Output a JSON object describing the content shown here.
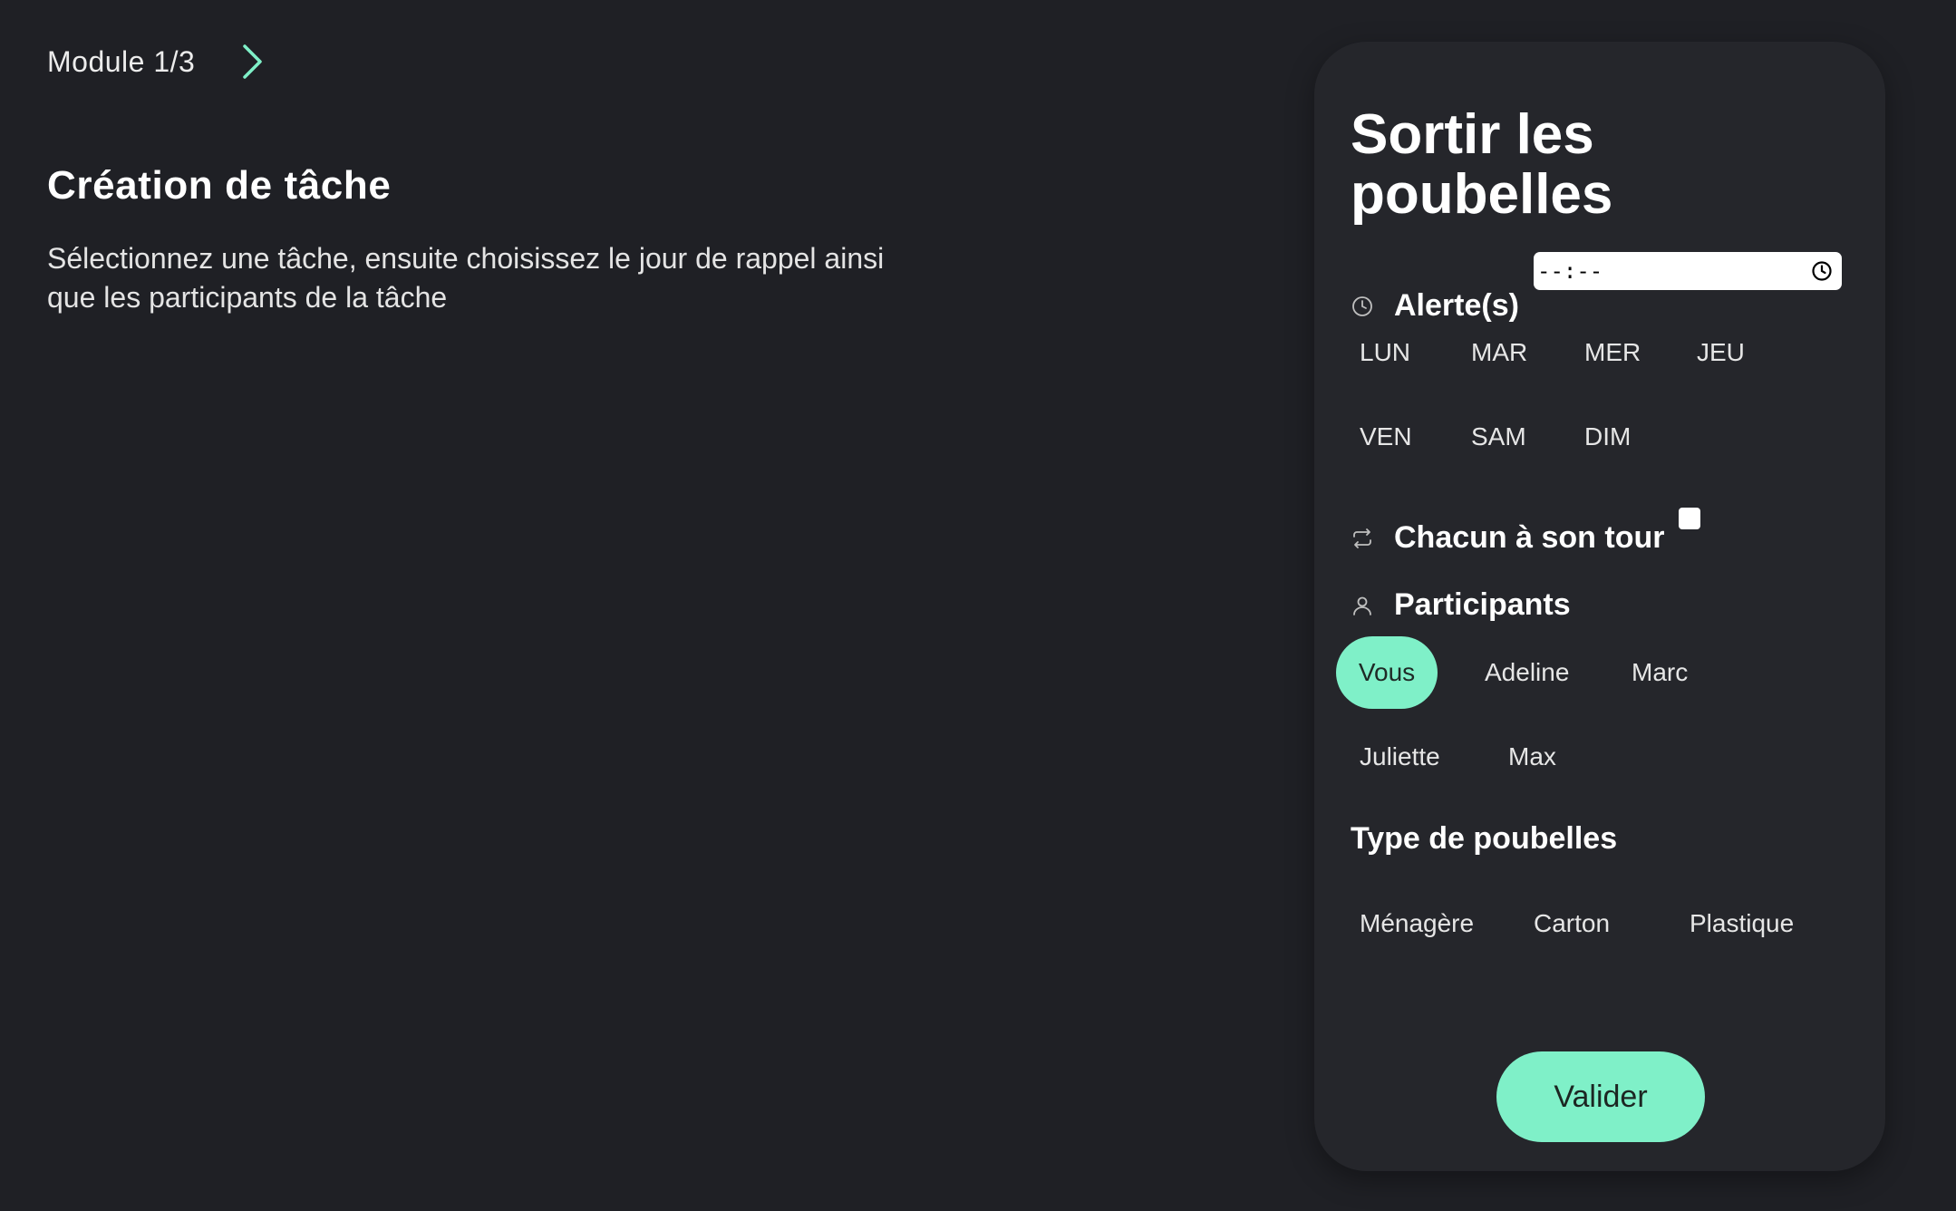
{
  "header": {
    "module_label": "Module 1/3",
    "next_icon": "chevron-right-icon"
  },
  "intro": {
    "title": "Création de tâche",
    "description": "Sélectionnez une tâche, ensuite choisissez le jour de rappel ainsi que les participants de la tâche"
  },
  "task_card": {
    "title": "Sortir les poubelles",
    "alert": {
      "icon": "clock-icon",
      "label": "Alerte(s)",
      "time_value": "--:--"
    },
    "days": [
      {
        "label": "LUN",
        "selected": false
      },
      {
        "label": "MAR",
        "selected": false
      },
      {
        "label": "MER",
        "selected": false
      },
      {
        "label": "JEU",
        "selected": false
      },
      {
        "label": "VEN",
        "selected": false
      },
      {
        "label": "SAM",
        "selected": false
      },
      {
        "label": "DIM",
        "selected": false
      }
    ],
    "rotation": {
      "icon": "repeat-icon",
      "label": "Chacun à son tour",
      "checked": false
    },
    "participants": {
      "icon": "user-icon",
      "label": "Participants",
      "items": [
        {
          "label": "Vous",
          "selected": true
        },
        {
          "label": "Adeline",
          "selected": false
        },
        {
          "label": "Marc",
          "selected": false
        },
        {
          "label": "Juliette",
          "selected": false
        },
        {
          "label": "Max",
          "selected": false
        }
      ]
    },
    "trash_types": {
      "label": "Type de poubelles",
      "items": [
        {
          "label": "Ménagère",
          "selected": false
        },
        {
          "label": "Carton",
          "selected": false
        },
        {
          "label": "Plastique",
          "selected": false
        }
      ]
    },
    "submit_label": "Valider"
  },
  "colors": {
    "background": "#1f2025",
    "card": "#25262b",
    "accent": "#7ff0c8",
    "text": "#ffffff"
  }
}
